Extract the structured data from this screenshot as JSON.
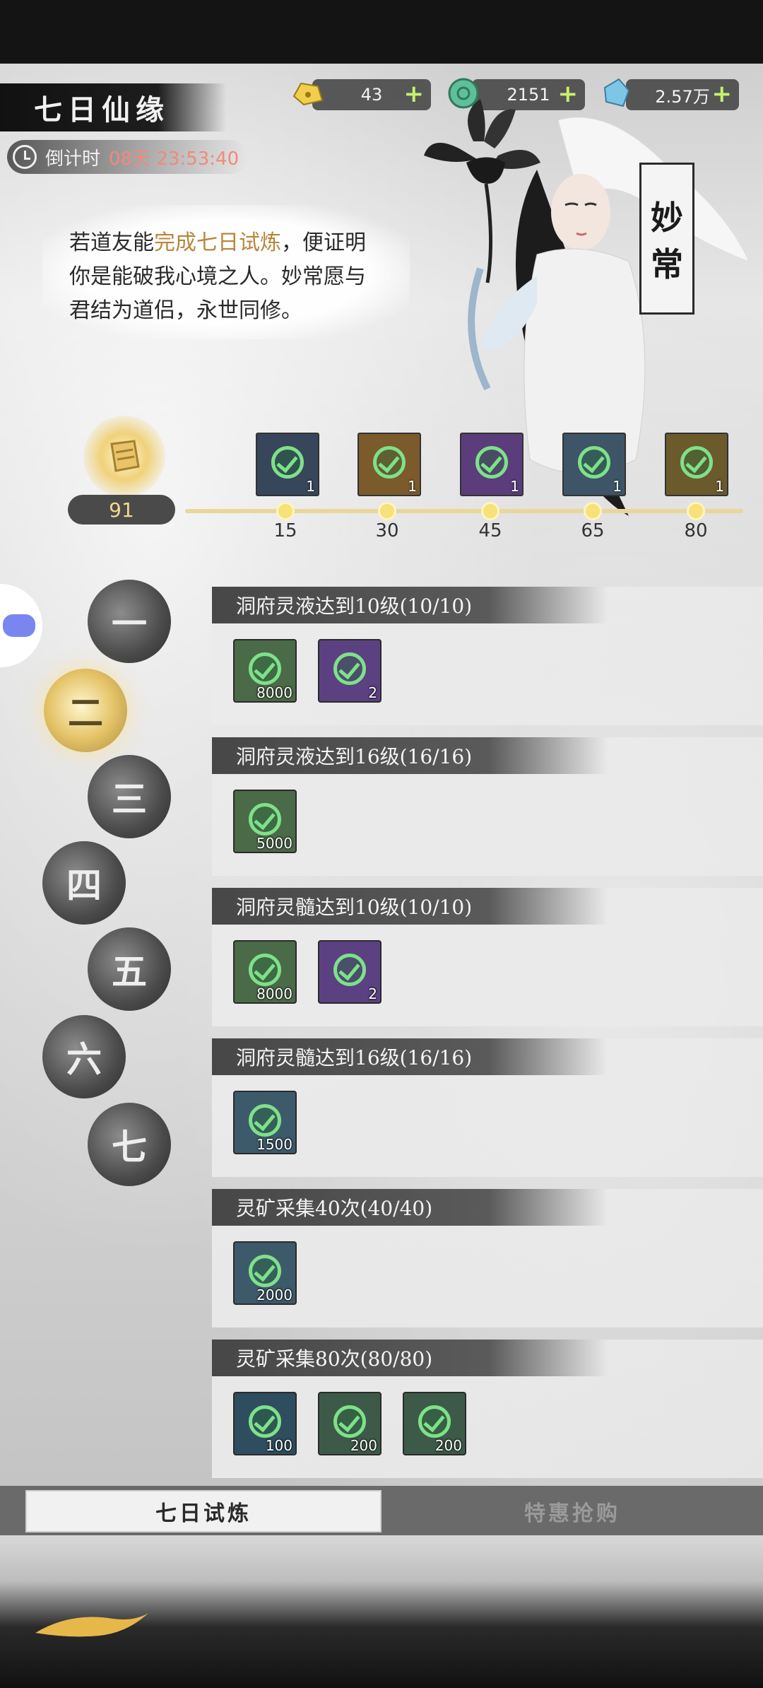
{
  "header": {
    "title": "七日仙缘",
    "countdown_label": "倒计时",
    "countdown_value": "08天 23:53:40"
  },
  "currencies": [
    {
      "icon": "gold-ingot-icon",
      "value": "43",
      "color": "#f2cf4a"
    },
    {
      "icon": "jade-coin-icon",
      "value": "2151",
      "color": "#5fbf9a"
    },
    {
      "icon": "spirit-stone-icon",
      "value": "2.57万",
      "color": "#7ec6e6"
    }
  ],
  "intro": {
    "text_before": "若道友能",
    "highlight": "完成七日试炼",
    "text_after": "，便证明你是能破我心境之人。妙常愿与君结为道侣，永世同修。"
  },
  "character": {
    "name_line1": "妙",
    "name_line2": "常"
  },
  "points": {
    "value": "91",
    "max": 80
  },
  "milestones": [
    {
      "points": "15",
      "count": "1",
      "color": "#37465a",
      "icon": "pill-bag-icon"
    },
    {
      "points": "30",
      "count": "1",
      "color": "#7b5a2b",
      "icon": "pill-bag-icon"
    },
    {
      "points": "45",
      "count": "1",
      "color": "#5a3d7a",
      "icon": "scroll-icon"
    },
    {
      "points": "65",
      "count": "1",
      "color": "#3d5566",
      "icon": "spirit-herb-icon"
    },
    {
      "points": "80",
      "count": "1",
      "color": "#6b5a2c",
      "icon": "jade-pendant-icon"
    }
  ],
  "days": [
    "一",
    "二",
    "三",
    "四",
    "五",
    "六",
    "七"
  ],
  "active_day": 1,
  "tasks": [
    {
      "title": "洞府灵液达到10级(10/10)",
      "rewards": [
        {
          "count": "8000",
          "color": "#4b6a48",
          "icon": "herb-bundle-icon"
        },
        {
          "count": "2",
          "color": "#5b4181",
          "icon": "scroll-icon"
        }
      ]
    },
    {
      "title": "洞府灵液达到16级(16/16)",
      "rewards": [
        {
          "count": "5000",
          "color": "#4b6a48",
          "icon": "herb-bundle-icon"
        }
      ]
    },
    {
      "title": "洞府灵髓达到10级(10/10)",
      "rewards": [
        {
          "count": "8000",
          "color": "#4b6a48",
          "icon": "herb-bundle-icon"
        },
        {
          "count": "2",
          "color": "#5b4181",
          "icon": "scroll-icon"
        }
      ]
    },
    {
      "title": "洞府灵髓达到16级(16/16)",
      "rewards": [
        {
          "count": "1500",
          "color": "#3d5a6a",
          "icon": "ore-icon"
        }
      ]
    },
    {
      "title": "灵矿采集40次(40/40)",
      "rewards": [
        {
          "count": "2000",
          "color": "#3d5a6a",
          "icon": "ore-icon"
        }
      ]
    },
    {
      "title": "灵矿采集80次(80/80)",
      "rewards": [
        {
          "count": "100",
          "color": "#2e4d5e",
          "icon": "spirit-orb-icon"
        },
        {
          "count": "200",
          "color": "#3d5a48",
          "icon": "spirit-grass-icon"
        },
        {
          "count": "200",
          "color": "#3d5a48",
          "icon": "spirit-grass-icon"
        }
      ]
    }
  ],
  "tabs": {
    "trial": "七日试炼",
    "shop": "特惠抢购"
  }
}
